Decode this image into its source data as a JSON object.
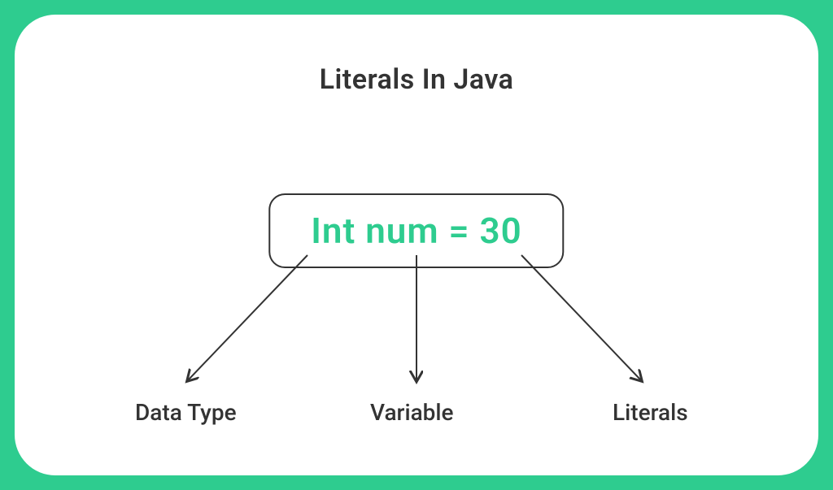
{
  "title": "Literals In Java",
  "code_expression": "Int num = 30",
  "labels": {
    "datatype": "Data Type",
    "variable": "Variable",
    "literals": "Literals"
  }
}
